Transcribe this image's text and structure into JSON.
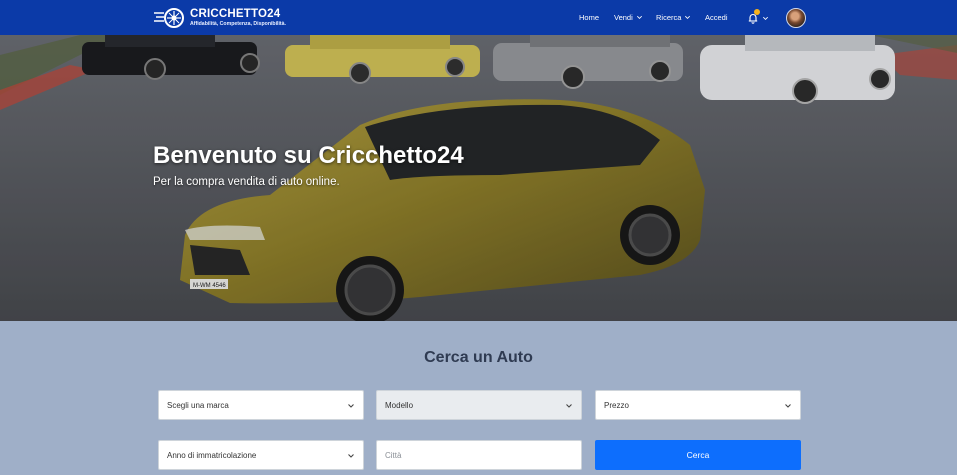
{
  "brand": {
    "title": "CRICCHETTO24",
    "tagline": "Affidabilità, Competenza, Disponibilità."
  },
  "nav": {
    "home": "Home",
    "vendi": "Vendi",
    "ricerca": "Ricerca",
    "accedi": "Accedi",
    "notification_color": "#f6b21b"
  },
  "hero": {
    "title": "Benvenuto su Cricchetto24",
    "subtitle": "Per la compra vendita di auto online.",
    "license_plate": "M-WM 4546"
  },
  "search": {
    "title": "Cerca un Auto",
    "brand_select": "Scegli una marca",
    "model_select": "Modello",
    "price_select": "Prezzo",
    "year_select": "Anno di immatricolazione",
    "city_placeholder": "Città",
    "submit_label": "Cerca"
  },
  "colors": {
    "navbar": "#0b3aa8",
    "search_bg": "#9fafc8",
    "button": "#0d6efd"
  }
}
